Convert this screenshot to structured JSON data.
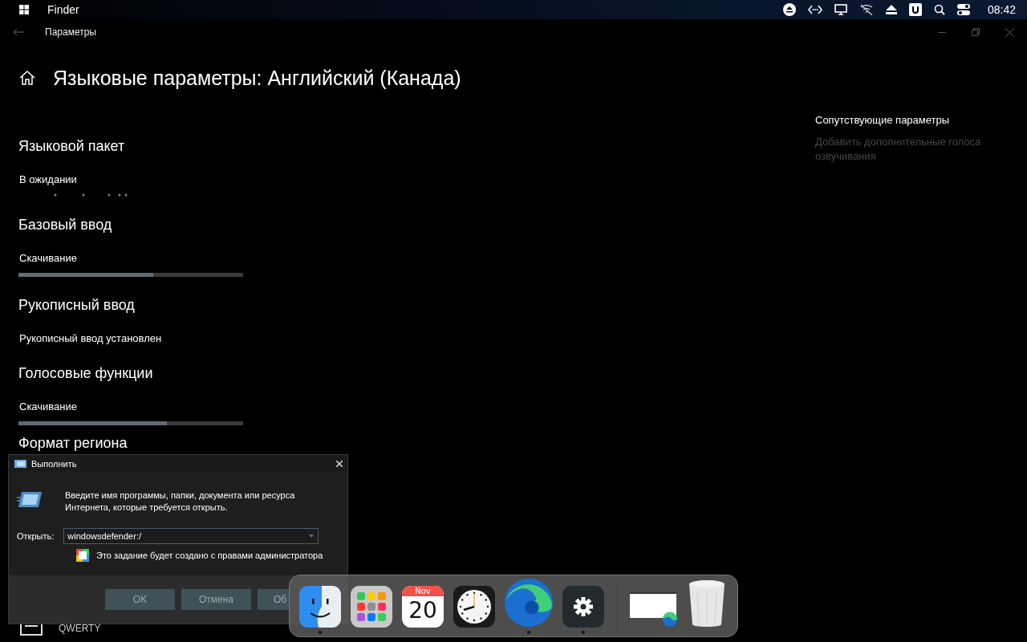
{
  "menubar": {
    "app": "Finder",
    "time": "08:42"
  },
  "settings": {
    "title": "Параметры",
    "heading": "Языковые параметры: Английский (Канада)",
    "sections": [
      {
        "heading": "Языковой пакет",
        "status": "В ожидании",
        "kind": "dots"
      },
      {
        "heading": "Базовый ввод",
        "status": "Скачивание",
        "kind": "progress",
        "level": 0.6
      },
      {
        "heading": "Рукописный ввод",
        "status": "Рукописный ввод установлен",
        "kind": "none"
      },
      {
        "heading": "Голосовые функции",
        "status": "Скачивание",
        "kind": "progress",
        "level": 0.66
      },
      {
        "heading": "Формат региона",
        "kind": "none"
      }
    ],
    "keyboard_item": "QWERTY",
    "related": {
      "title": "Сопутствующие параметры",
      "links": [
        {
          "label": "Добавить дополнительные голоса озвучивания",
          "disabled": true
        }
      ]
    }
  },
  "run_dialog": {
    "title": "Выполнить",
    "description": "Введите имя программы, папки, документа или ресурса Интернета, которые требуется открыть.",
    "open_label": "Открыть:",
    "value": "windowsdefender:/",
    "admin_note": "Это задание будет создано с правами администратора",
    "buttons": [
      "OK",
      "Отмена",
      "Об"
    ]
  },
  "dock": {
    "items": [
      {
        "kind": "finder",
        "running": true
      },
      {
        "kind": "launchpad",
        "running": false
      },
      {
        "kind": "calendar",
        "month": "Nov",
        "day": "20",
        "running": false
      },
      {
        "kind": "clock",
        "running": false
      },
      {
        "kind": "edge",
        "running": true
      },
      {
        "kind": "settings",
        "running": true
      },
      {
        "kind": "separator"
      },
      {
        "kind": "window",
        "running": false
      },
      {
        "kind": "trash",
        "running": false
      }
    ]
  }
}
